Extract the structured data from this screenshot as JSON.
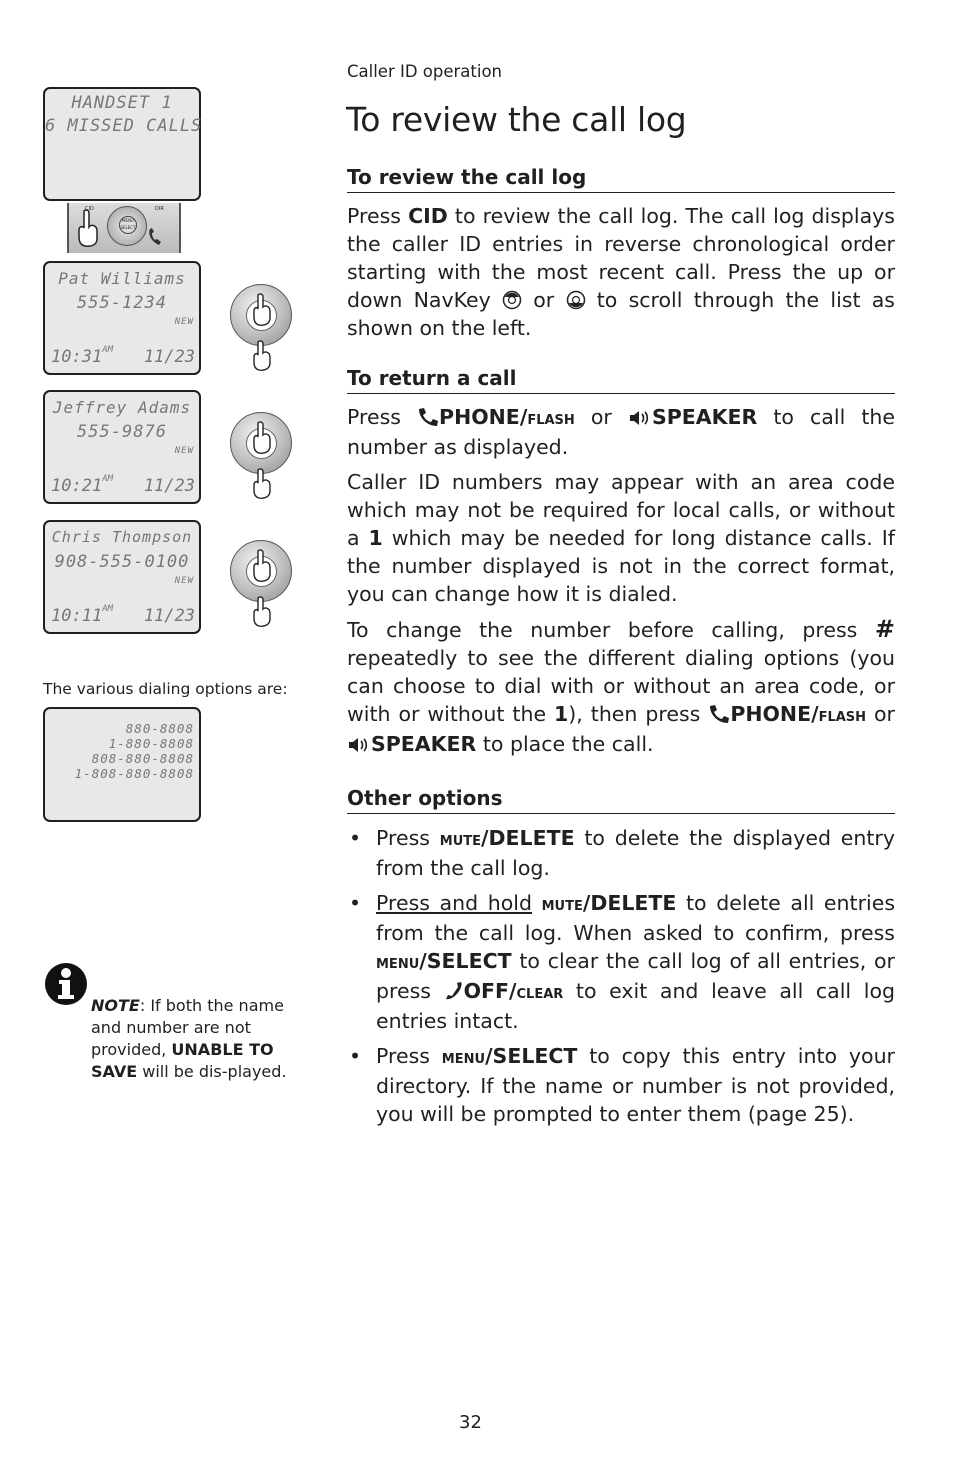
{
  "header": {
    "section_label": "Caller ID operation"
  },
  "page_title": "To review the call log",
  "left_column": {
    "screens": [
      {
        "lines": [
          "HANDSET 1",
          "6 MISSED CALLS"
        ]
      },
      {
        "name": "Pat Williams",
        "number": "555-1234",
        "badge": "NEW",
        "time": "10:31",
        "ampm": "AM",
        "date": "11/23"
      },
      {
        "name": "Jeffrey Adams",
        "number": "555-9876",
        "badge": "NEW",
        "time": "10:21",
        "ampm": "AM",
        "date": "11/23"
      },
      {
        "name": "Chris Thompson",
        "number": "908-555-0100",
        "badge": "NEW",
        "time": "10:11",
        "ampm": "AM",
        "date": "11/23"
      }
    ],
    "keypad_labels": {
      "cid": "CID",
      "dir": "DIR",
      "menu": "MENU",
      "select": "SELECT"
    },
    "dialing_options_caption": "The various dialing options are:",
    "dialing_options": [
      "880-8808",
      "1-880-8808",
      "808-880-8808",
      "1-808-880-8808"
    ],
    "note": {
      "label": "NOTE",
      "text_1": ": If both the name and number are not provided, ",
      "bold": "UNABLE TO SAVE",
      "text_2": " will be dis-played."
    }
  },
  "sections": {
    "review": {
      "heading": "To review the call log",
      "p1_a": "Press ",
      "p1_key": "CID",
      "p1_b": " to review the call log. The call log displays the caller ID entries in reverse chronological order starting with the most recent call. Press the up or down NavKey ",
      "p1_or": " or ",
      "p1_c": " to scroll through the list as shown on the left."
    },
    "return": {
      "heading": "To return a call",
      "p1_a": "Press ",
      "phone_key": "PHONE/",
      "flash_key": "flash",
      "p1_or": " or ",
      "speaker_key": "SPEAKER",
      "p1_b": " to call the number as displayed.",
      "p2_a": "Caller ID numbers may appear with an area code which may not be required for local calls, or without a ",
      "p2_one": "1",
      "p2_b": " which may be needed for long distance calls. If the number displayed is not in the correct format, you can change how it is dialed.",
      "p3_a": "To change the number before calling, press ",
      "p3_hash": "#",
      "p3_b": " repeatedly to see the different dialing options (you can choose to dial with or without an area code, or with or without the ",
      "p3_one": "1",
      "p3_c": "), then press ",
      "p3_or": " or ",
      "p3_d": " to place the call."
    },
    "other": {
      "heading": "Other options",
      "mute": "mute",
      "delete": "/DELETE",
      "menu": "menu",
      "select": "/SELECT",
      "off": "OFF/",
      "clear": "clear",
      "b1_a": "Press ",
      "b1_b": " to delete the displayed entry from the call log.",
      "b2_u": "Press and hold",
      "b2_a": " ",
      "b2_b": " to delete all entries from the call log. When asked to confirm, press ",
      "b2_c": " to clear the call log of all entries, or press ",
      "b2_d": " to exit and leave all call log entries intact.",
      "b3_a": "Press ",
      "b3_b": " to copy this entry into your directory. If the name or number is not provided, you will be prompted to enter them (page 25)."
    }
  },
  "footer": {
    "page_number": "32"
  }
}
